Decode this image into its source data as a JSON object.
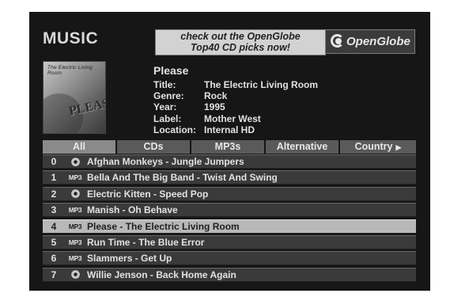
{
  "header": {
    "title": "MUSIC",
    "banner_line1": "check out the OpenGlobe",
    "banner_line2": "Top40 CD picks now!",
    "logo_text": "OpenGlobe"
  },
  "album": {
    "cover_band_text": "The Electric Living Room",
    "cover_word": "PLEASE",
    "name": "Please",
    "fields": [
      {
        "key": "Title:",
        "value": "The Electric Living Room"
      },
      {
        "key": "Genre:",
        "value": "Rock"
      },
      {
        "key": "Year:",
        "value": "1995"
      },
      {
        "key": "Label:",
        "value": "Mother West"
      },
      {
        "key": "Location:",
        "value": "Internal HD"
      }
    ]
  },
  "tabs": [
    {
      "label": "All",
      "active": true
    },
    {
      "label": "CDs",
      "active": false
    },
    {
      "label": "MP3s",
      "active": false
    },
    {
      "label": "Alternative",
      "active": false
    },
    {
      "label": "Country",
      "active": false,
      "arrow": "▶"
    }
  ],
  "tracks": [
    {
      "num": "0",
      "type": "cd",
      "badge": "",
      "label": "Afghan Monkeys - Jungle Jumpers"
    },
    {
      "num": "1",
      "type": "mp3",
      "badge": "MP3",
      "label": "Bella And The Big Band - Twist And Swing"
    },
    {
      "num": "2",
      "type": "cd",
      "badge": "",
      "label": "Electric Kitten - Speed Pop"
    },
    {
      "num": "3",
      "type": "mp3",
      "badge": "MP3",
      "label": "Manish - Oh Behave"
    },
    {
      "num": "4",
      "type": "mp3",
      "badge": "MP3",
      "label": "Please - The Electric Living Room",
      "selected": true
    },
    {
      "num": "5",
      "type": "mp3",
      "badge": "MP3",
      "label": "Run Time - The Blue Error"
    },
    {
      "num": "6",
      "type": "mp3",
      "badge": "MP3",
      "label": "Slammers - Get Up"
    },
    {
      "num": "7",
      "type": "cd",
      "badge": "",
      "label": "Willie Jenson - Back Home Again"
    }
  ]
}
